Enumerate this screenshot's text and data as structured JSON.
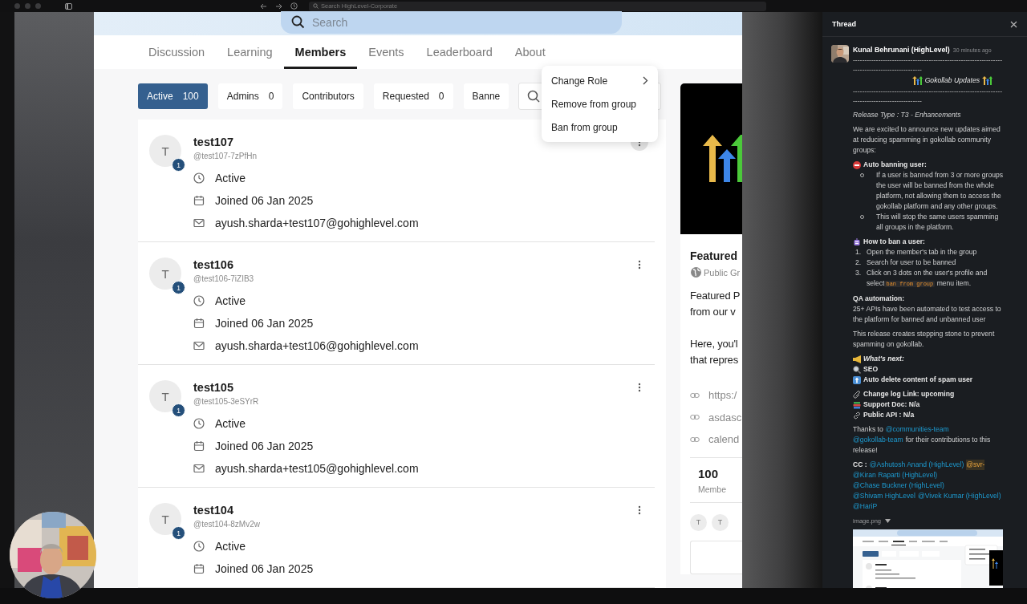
{
  "browser": {
    "search": {
      "placeholder": "Search HighLevel-Corporate"
    }
  },
  "app": {
    "search": {
      "placeholder": "Search"
    },
    "tabs": [
      {
        "label": "Discussion",
        "selected": false
      },
      {
        "label": "Learning",
        "selected": false
      },
      {
        "label": "Members",
        "selected": true
      },
      {
        "label": "Events",
        "selected": false
      },
      {
        "label": "Leaderboard",
        "selected": false
      },
      {
        "label": "About",
        "selected": false
      }
    ],
    "filters": [
      {
        "label": "Active",
        "count": "100",
        "selected": true
      },
      {
        "label": "Admins",
        "count": "0",
        "selected": false
      },
      {
        "label": "Contributors",
        "selected": false
      },
      {
        "label": "Requested",
        "count": "0",
        "selected": false
      },
      {
        "label": "Banne",
        "selected": false
      }
    ],
    "members": [
      {
        "initial": "T",
        "badge": "1",
        "name": "test107",
        "handle": "@test107-7zPfHn",
        "status": "Active",
        "joined": "Joined 06 Jan 2025",
        "email": "ayush.sharda+test107@gohighlevel.com",
        "menu_open": true
      },
      {
        "initial": "T",
        "badge": "1",
        "name": "test106",
        "handle": "@test106-7iZIB3",
        "status": "Active",
        "joined": "Joined 06 Jan 2025",
        "email": "ayush.sharda+test106@gohighlevel.com",
        "menu_open": false
      },
      {
        "initial": "T",
        "badge": "1",
        "name": "test105",
        "handle": "@test105-3eSYrR",
        "status": "Active",
        "joined": "Joined 06 Jan 2025",
        "email": "ayush.sharda+test105@gohighlevel.com",
        "menu_open": false
      },
      {
        "initial": "T",
        "badge": "1",
        "name": "test104",
        "handle": "@test104-8zMv2w",
        "status": "Active",
        "joined": "Joined 06 Jan 2025",
        "menu_open": false
      }
    ],
    "menu": {
      "items": [
        {
          "label": "Change Role",
          "submenu": true
        },
        {
          "label": "Remove from group",
          "submenu": false
        },
        {
          "label": "Ban from group",
          "submenu": false
        }
      ]
    },
    "group_card": {
      "title": "Featured",
      "visibility": "Public Gr",
      "paragraphs": [
        [
          "Featured P",
          "from our v"
        ],
        [
          "Here, you'l",
          "that repres"
        ]
      ],
      "links": [
        "https:/",
        "asdasc",
        "calend"
      ],
      "stat_value": "100",
      "stat_label": "Membe",
      "avatars": [
        "T",
        "T"
      ]
    }
  },
  "thread": {
    "title": "Thread",
    "author": "Kunal Behrunani (HighLevel)",
    "time": "30 minutes ago",
    "blocks": [
      {
        "kind": "rule",
        "text": "-----------------------------------------------------------------------------------------------"
      },
      {
        "kind": "banner",
        "text": "Gokollab Updates"
      },
      {
        "kind": "rule",
        "text": "-----------------------------------------------------------------------------------------------"
      },
      {
        "kind": "italic",
        "text": "Release Type : T3 -  Enhancements"
      },
      {
        "kind": "para",
        "text": "We are excited to announce new updates aimed at reducing spamming in gokollab community groups:"
      },
      {
        "kind": "emoji",
        "lines": [
          {
            "kind": "stop",
            "text": "Auto banning user:",
            "italic": false
          }
        ]
      },
      {
        "kind": "bullets",
        "items": [
          "If a user is banned from 3 or more groups the user will be banned from the whole platform, not allowing them to access the gokollab platform and any other groups.",
          "This will stop the same users spamming all groups in the platform."
        ]
      },
      {
        "kind": "emoji",
        "lines": [
          {
            "kind": "robot",
            "text": "How to ban a user:",
            "italic": false
          }
        ]
      },
      {
        "kind": "numbered",
        "items": [
          {
            "number": "1.",
            "text": "Open the member's tab in the group"
          },
          {
            "number": "2.",
            "text": "Search for user to be banned"
          },
          {
            "number": "3.",
            "text": "Click on 3 dots on the user's profile and select",
            "code": "ban from group",
            "after": "menu item."
          }
        ]
      },
      {
        "kind": "titled",
        "title": "QA automation:",
        "text": "25+ APIs have been automated to test access to the platform for banned and unbanned user"
      },
      {
        "kind": "para",
        "text": "This release creates stepping stone to prevent spamming on gokollab."
      },
      {
        "kind": "emoji",
        "lines": [
          {
            "kind": "megaphone",
            "text": "What's next:",
            "italic": true
          },
          {
            "kind": "magnifier",
            "text": "SEO",
            "italic": false
          },
          {
            "kind": "arrow-up",
            "text": "Auto delete content of spam user",
            "italic": false
          }
        ]
      },
      {
        "kind": "emoji",
        "lines": [
          {
            "kind": "paperclip",
            "text": "Change log Link: upcoming",
            "italic": false
          },
          {
            "kind": "books",
            "text": "Support Doc: N/a",
            "italic": false
          },
          {
            "kind": "link",
            "text": "Public API : N/a",
            "italic": false
          }
        ]
      },
      {
        "kind": "mentions",
        "before": "Thanks to",
        "label_bold": false,
        "mentions": [
          {
            "text": "@communities-team",
            "highlight": false
          },
          {
            "text": "@gokollab-team",
            "highlight": false
          }
        ],
        "after": "for their contributions to this release!"
      },
      {
        "kind": "mentions",
        "before": "CC :",
        "label_bold": true,
        "mentions": [
          {
            "text": "@Ashutosh Anand (HighLevel)",
            "highlight": false
          },
          {
            "text": "@svr-",
            "highlight": true
          },
          {
            "text": "@Kiran Raparti (HighLevel)",
            "highlight": false
          },
          {
            "text": "@Chase Buckner (HighLevel)",
            "highlight": false
          },
          {
            "text": "@Shivam HighLevel",
            "highlight": false
          },
          {
            "text": "@Vivek Kumar (HighLevel)",
            "highlight": false
          },
          {
            "text": "@HariP",
            "highlight": false
          }
        ]
      },
      {
        "kind": "attachment",
        "name": "image.png"
      }
    ]
  }
}
